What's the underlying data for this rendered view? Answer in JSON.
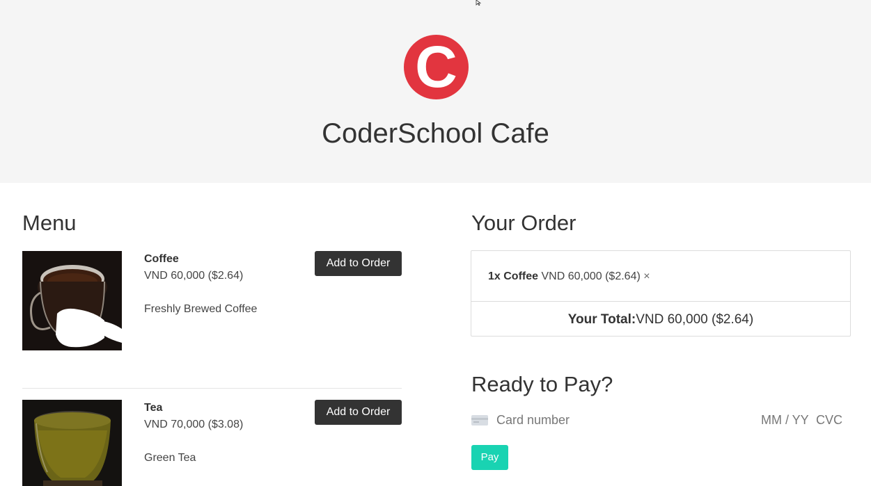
{
  "header": {
    "logo_letter": "C",
    "title": "CoderSchool Cafe",
    "brand_color": "#e2353f",
    "background_color": "#f5f5f5"
  },
  "menu": {
    "heading": "Menu",
    "add_button_label": "Add to Order",
    "items": [
      {
        "name": "Coffee",
        "price": "VND 60,000 ($2.64)",
        "description": "Freshly Brewed Coffee",
        "image": "coffee-cup-photo"
      },
      {
        "name": "Tea",
        "price": "VND 70,000 ($3.08)",
        "description": "Green Tea",
        "image": "green-tea-cup-photo"
      }
    ]
  },
  "order": {
    "heading": "Your Order",
    "lines": [
      {
        "qty_name": "1x Coffee",
        "price": "VND 60,000 ($2.64)",
        "remove": "×"
      }
    ],
    "total_label": "Your Total:",
    "total_value": "VND 60,000 ($2.64)"
  },
  "payment": {
    "heading": "Ready to Pay?",
    "card_icon": "credit-card-icon",
    "card_placeholder": "Card number",
    "expiry_placeholder": "MM / YY",
    "cvc_placeholder": "CVC",
    "pay_label": "Pay",
    "pay_color": "#19d3b2"
  }
}
